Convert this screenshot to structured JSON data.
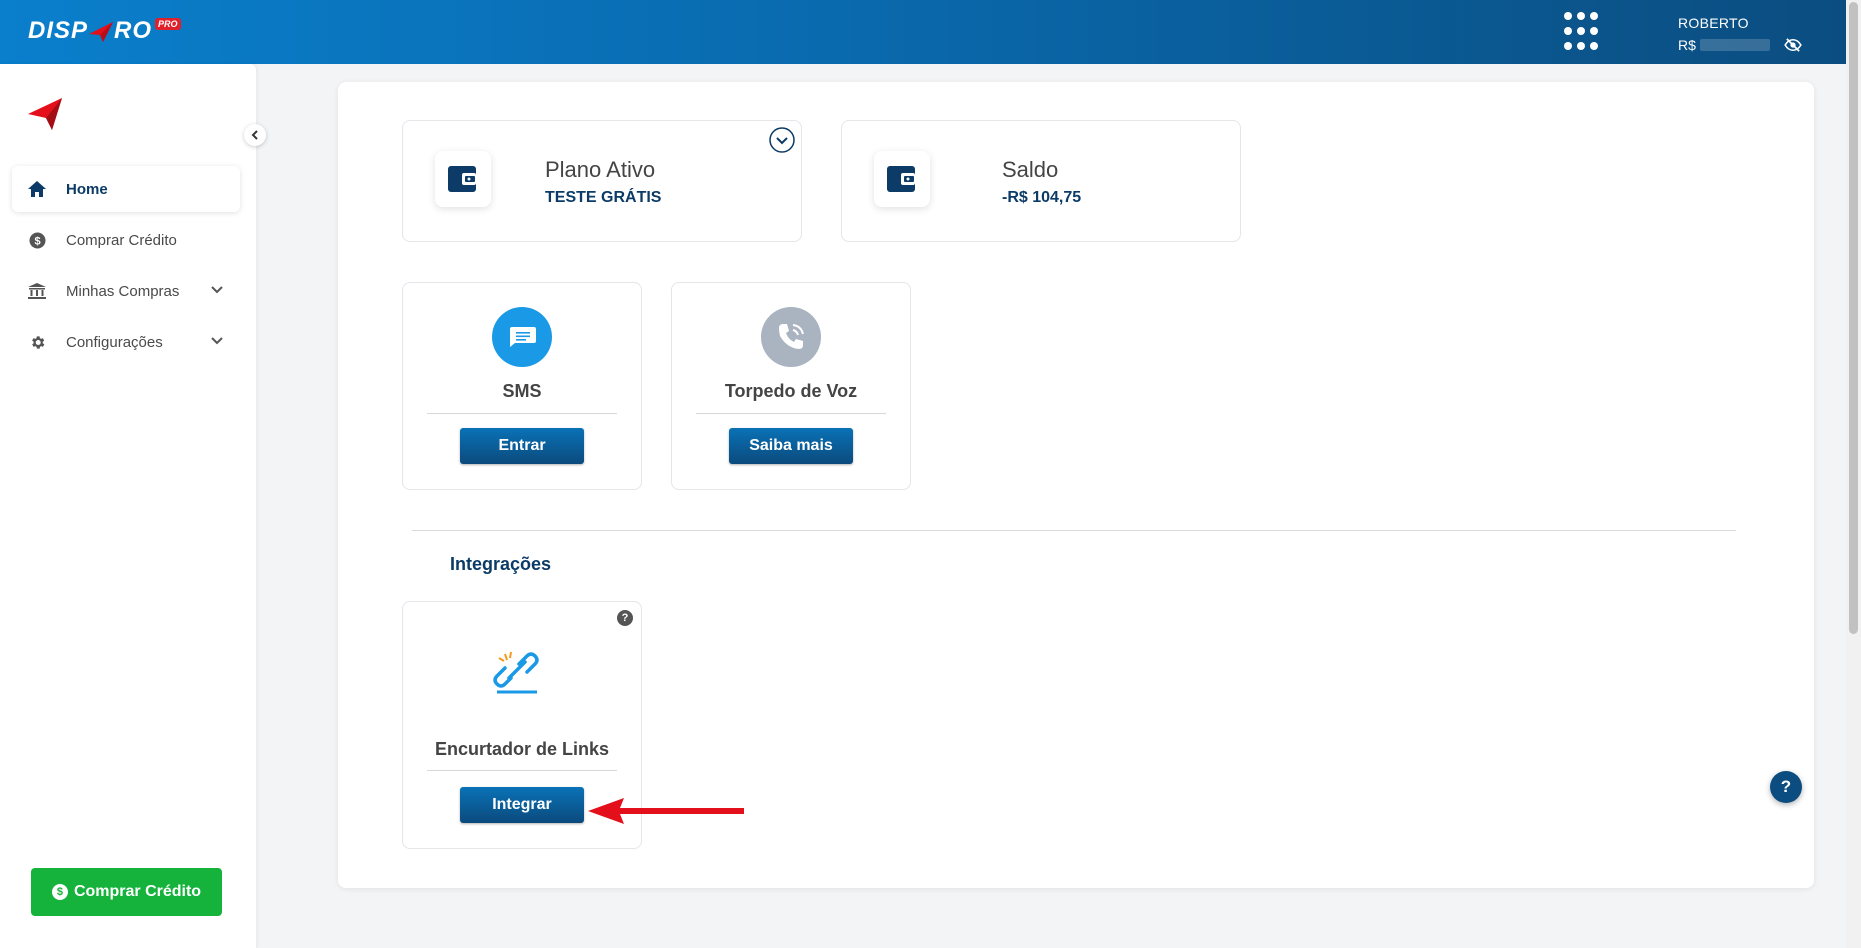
{
  "header": {
    "logo_left": "DISP",
    "logo_right": "RO",
    "logo_badge": "PRO",
    "user_name": "ROBERTO",
    "balance_prefix": "R$"
  },
  "sidebar": {
    "items": [
      {
        "label": "Home",
        "icon": "home-icon",
        "active": true
      },
      {
        "label": "Comprar Crédito",
        "icon": "dollar-coin-icon"
      },
      {
        "label": "Minhas Compras",
        "icon": "bank-icon",
        "expandable": true
      },
      {
        "label": "Configurações",
        "icon": "gear-icon",
        "expandable": true
      }
    ],
    "buy_button_label": "Comprar Crédito",
    "buy_button_icon": "$"
  },
  "stats": {
    "plan": {
      "title": "Plano Ativo",
      "value": "TESTE GRÁTIS"
    },
    "balance": {
      "title": "Saldo",
      "value": "-R$ 104,75"
    }
  },
  "services": [
    {
      "title": "SMS",
      "button": "Entrar",
      "icon": "sms-chat-icon",
      "color": "#1a9ae6"
    },
    {
      "title": "Torpedo de Voz",
      "button": "Saiba mais",
      "icon": "phone-call-icon",
      "color": "#a9b4c0"
    }
  ],
  "integrations": {
    "section_title": "Integrações",
    "items": [
      {
        "title": "Encurtador de Links",
        "button": "Integrar",
        "icon": "link-shortener-icon",
        "help": "?"
      }
    ]
  },
  "help_fab": "?",
  "colors": {
    "primary": "#0b4a7d",
    "accent_green": "#16b33c",
    "annotation_red": "#e3101b"
  }
}
